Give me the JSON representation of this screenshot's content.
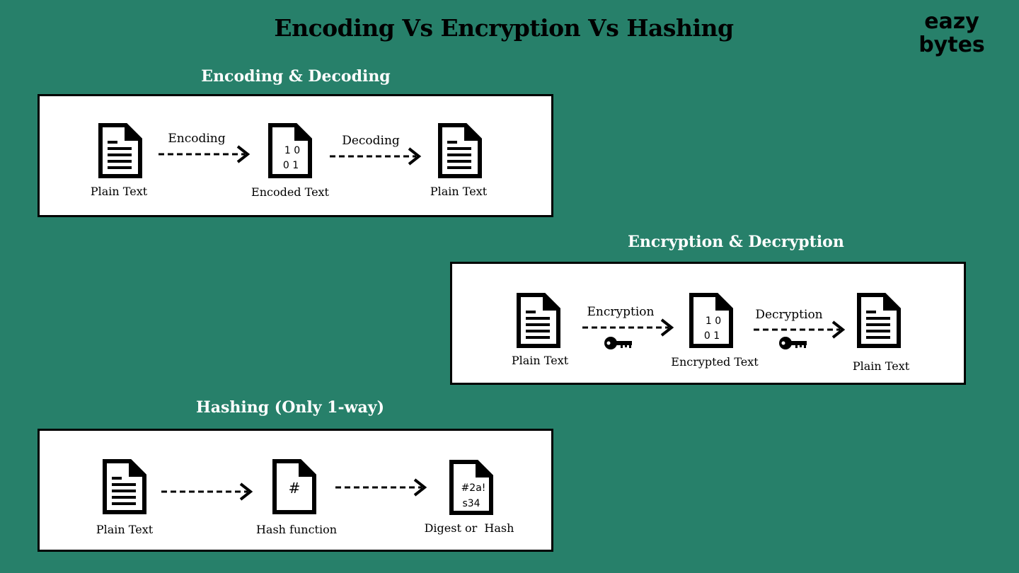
{
  "title": "Encoding Vs Encryption Vs Hashing",
  "logo": {
    "line1": "eazy",
    "line2": "bytes"
  },
  "encoding": {
    "title": "Encoding & Decoding",
    "step1_label": "Encoding",
    "step2_label": "Decoding",
    "doc1_caption": "Plain Text",
    "doc2_caption": "Encoded Text",
    "doc2_line1": "1 0",
    "doc2_line2": "0 1",
    "doc3_caption": "Plain Text"
  },
  "encryption": {
    "title": "Encryption & Decryption",
    "step1_label": "Encryption",
    "step2_label": "Decryption",
    "doc1_caption": "Plain Text",
    "doc2_caption": "Encrypted Text",
    "doc2_line1": "1 0",
    "doc2_line2": "0 1",
    "doc3_caption": "Plain Text",
    "key_icon": "key-icon"
  },
  "hashing": {
    "title": "Hashing (Only 1-way)",
    "doc1_caption": "Plain Text",
    "doc2_caption": "Hash function",
    "doc2_symbol": "#",
    "doc3_caption": "Digest or  Hash",
    "doc3_line1": "#2a!",
    "doc3_line2": "s34"
  },
  "colors": {
    "background": "#27806a",
    "panel": "#ffffff",
    "ink": "#000000"
  }
}
